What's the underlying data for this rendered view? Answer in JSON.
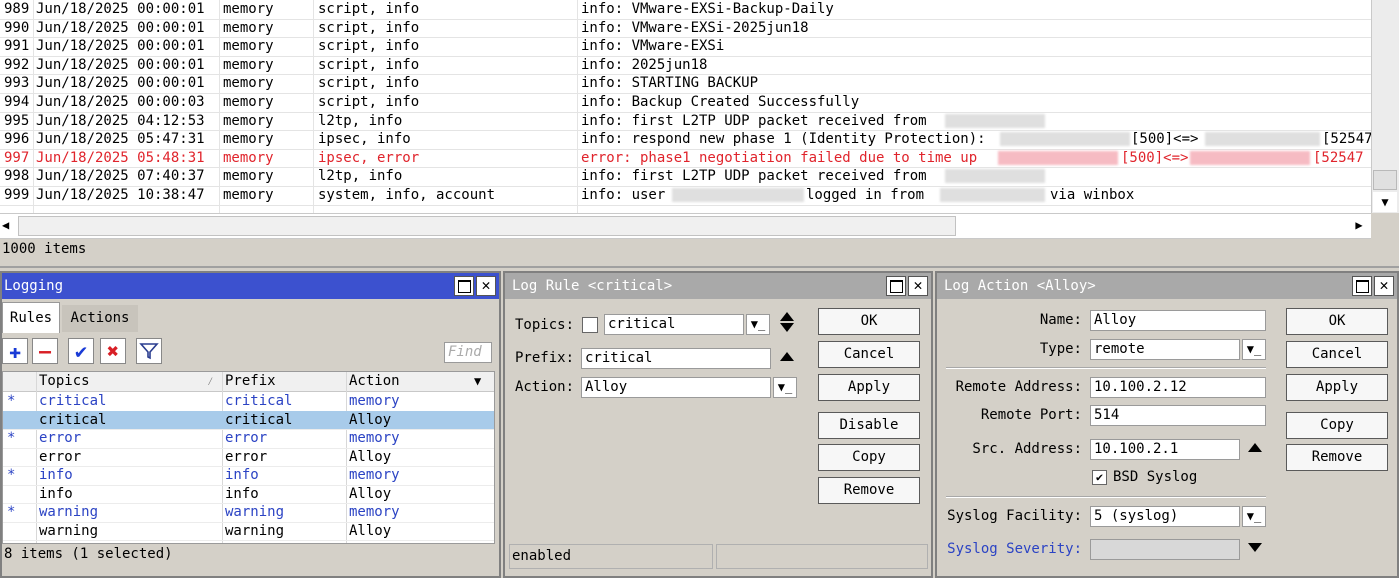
{
  "log": {
    "rows": [
      {
        "num": "989",
        "time": "Jun/18/2025 00:00:01",
        "buffer": "memory",
        "topics": "script, info",
        "message": "info: VMware-EXSi-Backup-Daily"
      },
      {
        "num": "990",
        "time": "Jun/18/2025 00:00:01",
        "buffer": "memory",
        "topics": "script, info",
        "message": "info: VMware-EXSi-2025jun18"
      },
      {
        "num": "991",
        "time": "Jun/18/2025 00:00:01",
        "buffer": "memory",
        "topics": "script, info",
        "message": "info: VMware-EXSi"
      },
      {
        "num": "992",
        "time": "Jun/18/2025 00:00:01",
        "buffer": "memory",
        "topics": "script, info",
        "message": "info: 2025jun18"
      },
      {
        "num": "993",
        "time": "Jun/18/2025 00:00:01",
        "buffer": "memory",
        "topics": "script, info",
        "message": "info: STARTING BACKUP"
      },
      {
        "num": "994",
        "time": "Jun/18/2025 00:00:03",
        "buffer": "memory",
        "topics": "script, info",
        "message": "info: Backup Created Successfully"
      },
      {
        "num": "995",
        "time": "Jun/18/2025 04:12:53",
        "buffer": "memory",
        "topics": "l2tp, info",
        "message": "info: first L2TP UDP packet received from"
      },
      {
        "num": "996",
        "time": "Jun/18/2025 05:47:31",
        "buffer": "memory",
        "topics": "ipsec, info",
        "message": "info: respond new phase 1 (Identity Protection):",
        "msg_a": "[500]<=>",
        "msg_b": "[52547"
      },
      {
        "num": "997",
        "time": "Jun/18/2025 05:48:31",
        "buffer": "memory",
        "topics": "ipsec, error",
        "message": "error: phase1 negotiation failed due to time up",
        "msg_a": "[500]<=>",
        "msg_b": "[52547"
      },
      {
        "num": "998",
        "time": "Jun/18/2025 07:40:37",
        "buffer": "memory",
        "topics": "l2tp, info",
        "message": "info: first L2TP UDP packet received from"
      },
      {
        "num": "999",
        "time": "Jun/18/2025 10:38:47",
        "buffer": "memory",
        "topics": "system, info, account",
        "message": "info: user",
        "msg_a": "logged in from",
        "msg_b": "via winbox"
      }
    ],
    "item_count": "1000 items"
  },
  "logging": {
    "title": "Logging",
    "tabs": [
      "Rules",
      "Actions"
    ],
    "find_placeholder": "Find",
    "columns": [
      "Topics",
      "Prefix",
      "Action"
    ],
    "rows": [
      {
        "flag": "*",
        "topics": "critical",
        "prefix": "critical",
        "action": "memory"
      },
      {
        "flag": "",
        "topics": "critical",
        "prefix": "critical",
        "action": "Alloy"
      },
      {
        "flag": "*",
        "topics": "error",
        "prefix": "error",
        "action": "memory"
      },
      {
        "flag": "",
        "topics": "error",
        "prefix": "error",
        "action": "Alloy"
      },
      {
        "flag": "*",
        "topics": "info",
        "prefix": "info",
        "action": "memory"
      },
      {
        "flag": "",
        "topics": "info",
        "prefix": "info",
        "action": "Alloy"
      },
      {
        "flag": "*",
        "topics": "warning",
        "prefix": "warning",
        "action": "memory"
      },
      {
        "flag": "",
        "topics": "warning",
        "prefix": "warning",
        "action": "Alloy"
      }
    ],
    "count": "8 items (1 selected)"
  },
  "log_rule": {
    "title": "Log Rule <critical>",
    "topics_label": "Topics:",
    "topics_value": "critical",
    "prefix_label": "Prefix:",
    "prefix_value": "critical",
    "action_label": "Action:",
    "action_value": "Alloy",
    "buttons": {
      "ok": "OK",
      "cancel": "Cancel",
      "apply": "Apply",
      "disable": "Disable",
      "copy": "Copy",
      "remove": "Remove"
    },
    "status": "enabled"
  },
  "log_action": {
    "title": "Log Action <Alloy>",
    "name_label": "Name:",
    "name_value": "Alloy",
    "type_label": "Type:",
    "type_value": "remote",
    "remote_address_label": "Remote Address:",
    "remote_address_value": "10.100.2.12",
    "remote_port_label": "Remote Port:",
    "remote_port_value": "514",
    "src_address_label": "Src. Address:",
    "src_address_value": "10.100.2.1",
    "bsd_syslog_label": "BSD Syslog",
    "bsd_syslog_checked": true,
    "syslog_facility_label": "Syslog Facility:",
    "syslog_facility_value": "5 (syslog)",
    "syslog_severity_label": "Syslog Severity:",
    "syslog_severity_value": "",
    "buttons": {
      "ok": "OK",
      "cancel": "Cancel",
      "apply": "Apply",
      "copy": "Copy",
      "remove": "Remove"
    }
  },
  "colors": {
    "error_text": "#e0242c",
    "dynamic_text": "#2b43c4",
    "active_title": "#3c51cf",
    "inactive_title": "#a9a9a9",
    "selected_row": "#a8cbea"
  }
}
